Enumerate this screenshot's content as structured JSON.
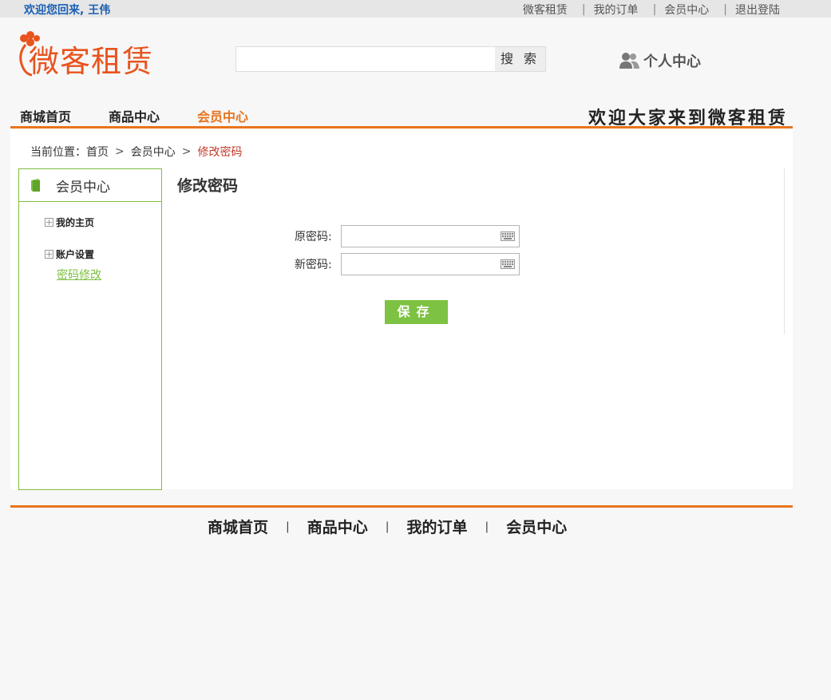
{
  "topbar": {
    "welcome": "欢迎您回来, 王伟",
    "links": [
      "微客租赁",
      "我的订单",
      "会员中心",
      "退出登陆"
    ],
    "separator": "|"
  },
  "header": {
    "logo_text": "微客租赁",
    "search_placeholder": "",
    "search_button": "搜 索",
    "personal_center": "个人中心"
  },
  "nav": {
    "items": [
      "商城首页",
      "商品中心",
      "会员中心"
    ],
    "active_index": 2,
    "slogan": "欢迎大家来到微客租赁"
  },
  "breadcrumb": {
    "prefix": "当前位置：",
    "items": [
      "首页",
      "会员中心",
      "修改密码"
    ],
    "arrow": ">"
  },
  "sidebar": {
    "title": "会员中心",
    "groups": [
      "我的主页",
      "账户设置"
    ],
    "sub_item": "密码修改"
  },
  "form": {
    "title": "修改密码",
    "old_label": "原密码:",
    "new_label": "新密码:",
    "old_value": "",
    "new_value": "",
    "save_button": "保存"
  },
  "footer": {
    "links": [
      "商城首页",
      "商品中心",
      "我的订单",
      "会员中心"
    ],
    "separator": "|"
  },
  "colors": {
    "accent_orange": "#e8741e",
    "accent_green": "#7dc242",
    "link_blue": "#1a5fb4",
    "crumb_red": "#c0392b"
  }
}
